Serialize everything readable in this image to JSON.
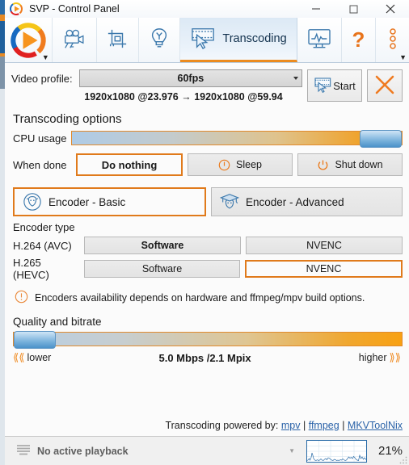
{
  "window": {
    "title": "SVP - Control Panel",
    "app_icon": "svp-logo-icon",
    "minimize": "—",
    "maximize": "☐",
    "close": "✕"
  },
  "toolbar": {
    "items": [
      {
        "name": "svp-logo",
        "icon": "svp-logo-icon",
        "label": ""
      },
      {
        "name": "video-profiles",
        "icon": "movie-camera-icon",
        "label": ""
      },
      {
        "name": "crop",
        "icon": "crop-icon",
        "label": ""
      },
      {
        "name": "lightbulb",
        "icon": "lightbulb-icon",
        "label": ""
      },
      {
        "name": "transcoding",
        "icon": "film-cursor-icon",
        "label": "Transcoding",
        "active": true
      },
      {
        "name": "statistics",
        "icon": "monitor-graph-icon",
        "label": ""
      },
      {
        "name": "help",
        "icon": "question-mark-icon",
        "label": "?"
      },
      {
        "name": "more",
        "icon": "kebab-menu-icon",
        "label": ""
      }
    ]
  },
  "video_profile": {
    "label": "Video profile:",
    "selected": "60fps",
    "conversion": "1920x1080 @23.976 → 1920x1080 @59.94",
    "start_label": "Start",
    "start_icon": "film-cursor-icon",
    "cancel_icon": "orange-x-icon"
  },
  "transcoding_options": {
    "title": "Transcoding options",
    "cpu_usage": {
      "label": "CPU usage",
      "value": 100
    },
    "when_done": {
      "label": "When done",
      "options": [
        {
          "label": "Do nothing",
          "selected": true,
          "icon": ""
        },
        {
          "label": "Sleep",
          "selected": false,
          "icon": "sleep-icon"
        },
        {
          "label": "Shut down",
          "selected": false,
          "icon": "power-icon"
        }
      ]
    }
  },
  "encoder": {
    "tabs": [
      {
        "label": "Encoder - Basic",
        "icon": "sheep-icon",
        "selected": true
      },
      {
        "label": "Encoder - Advanced",
        "icon": "sheep-graduate-icon",
        "selected": false
      }
    ],
    "type_title": "Encoder type",
    "rows": [
      {
        "name": "H.264 (AVC)",
        "options": [
          {
            "label": "Software",
            "state": "bold"
          },
          {
            "label": "NVENC",
            "state": "normal"
          }
        ]
      },
      {
        "name": "H.265 (HEVC)",
        "options": [
          {
            "label": "Software",
            "state": "normal"
          },
          {
            "label": "NVENC",
            "state": "outlined"
          }
        ]
      }
    ],
    "note": "Encoders availability depends on hardware and ffmpeg/mpv build options.",
    "note_icon": "warning-circle-icon"
  },
  "quality": {
    "title": "Quality and bitrate",
    "value_percent": 3,
    "lower_label": "lower",
    "higher_label": "higher",
    "readout": "5.0 Mbps /2.1 Mpix"
  },
  "footer": {
    "prefix": "Transcoding powered by:",
    "links": [
      "mpv",
      "ffmpeg",
      "MKVToolNix"
    ],
    "sep": "|"
  },
  "statusbar": {
    "playback_icon": "lines-icon",
    "playback_text": "No active playback",
    "expand_icon": "chevron-down-icon",
    "cpu_percent": "21%",
    "graph_name": "cpu-history-graph"
  },
  "colors": {
    "accent_orange": "#e07a1b",
    "accent_blue": "#2a6ca8",
    "link_blue": "#2a62a8"
  }
}
